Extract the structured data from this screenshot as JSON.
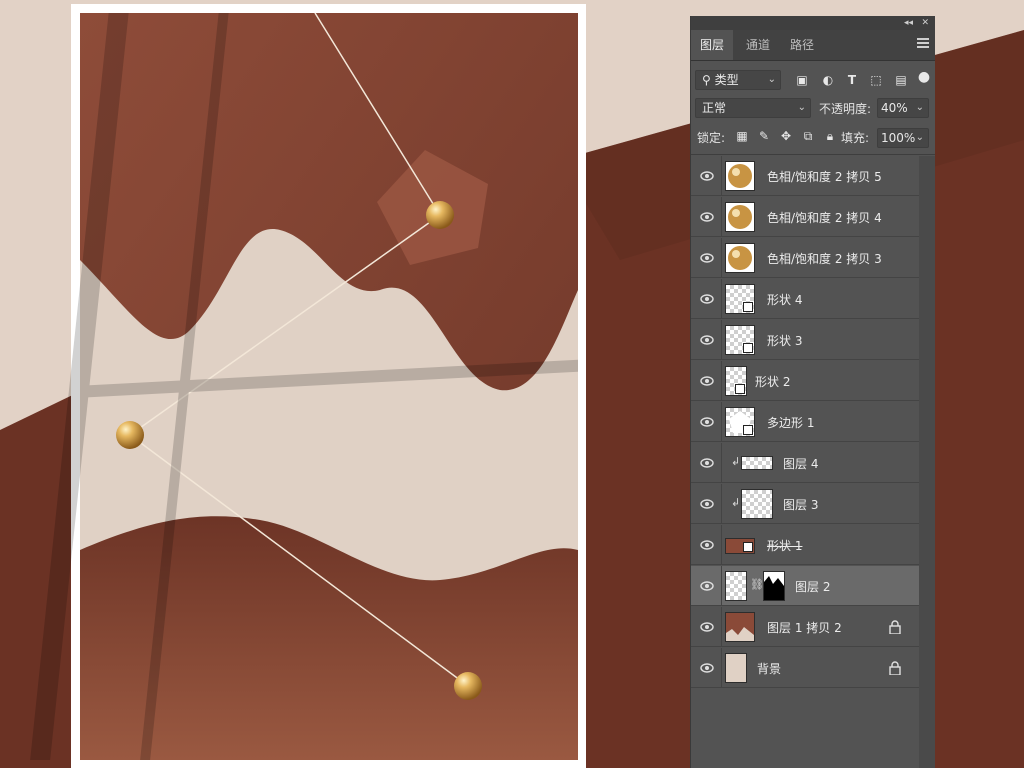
{
  "layers_panel": {
    "tabs": [
      {
        "label": "图层",
        "active": true
      },
      {
        "label": "通道",
        "active": false
      },
      {
        "label": "路径",
        "active": false
      }
    ],
    "filter": {
      "kind_label": "类型"
    },
    "blend": {
      "mode": "正常",
      "opacity_label": "不透明度:",
      "opacity_value": "40%"
    },
    "lock": {
      "label": "锁定:",
      "fill_label": "填充:",
      "fill_value": "100%"
    },
    "layers": [
      {
        "name": "色相/饱和度 2 拷贝 5",
        "thumb": "pearl"
      },
      {
        "name": "色相/饱和度 2 拷贝 4",
        "thumb": "pearl"
      },
      {
        "name": "色相/饱和度 2 拷贝 3",
        "thumb": "pearl"
      },
      {
        "name": "形状 4",
        "thumb": "shape"
      },
      {
        "name": "形状 3",
        "thumb": "shape"
      },
      {
        "name": "形状 2",
        "thumb": "shape"
      },
      {
        "name": "多边形 1",
        "thumb": "polygon"
      },
      {
        "name": "图层 4",
        "thumb": "clip"
      },
      {
        "name": "图层 3",
        "thumb": "clip"
      },
      {
        "name": "形状 1",
        "thumb": "brown-shape"
      },
      {
        "name": "图层 2",
        "thumb": "masked",
        "selected": true
      },
      {
        "name": "图层 1 拷贝 2",
        "thumb": "brown",
        "locked": true
      },
      {
        "name": "背景",
        "thumb": "beige",
        "locked": true
      }
    ]
  },
  "colors": {
    "panel_bg": "#535353",
    "poster_brown": "#8a4a38",
    "poster_beige": "#e0d1c5",
    "accent_gold": "#d4a14a"
  }
}
